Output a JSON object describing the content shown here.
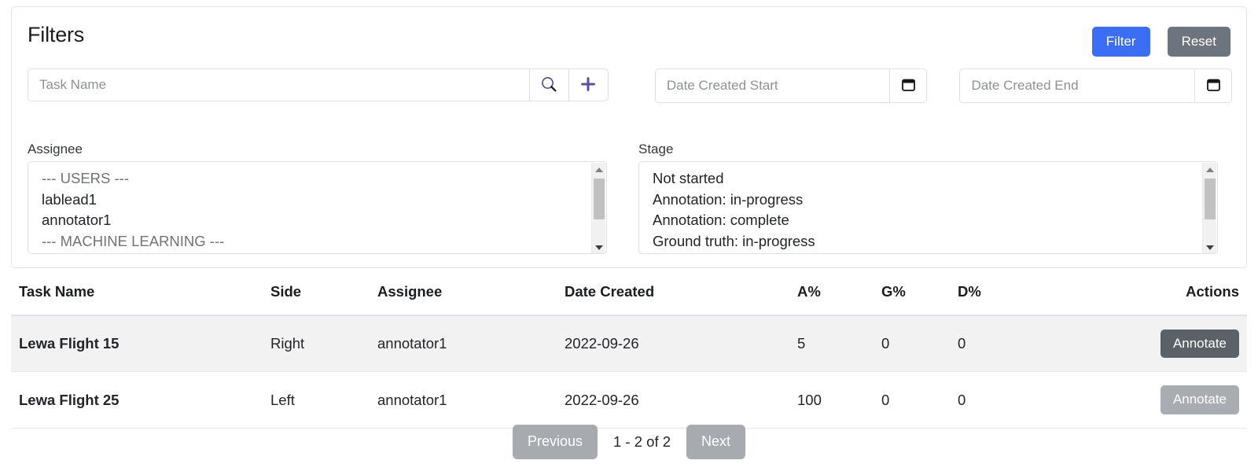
{
  "filters": {
    "title": "Filters",
    "filter_button": "Filter",
    "reset_button": "Reset",
    "task_name_placeholder": "Task Name",
    "task_name_value": "",
    "search_icon": "search-icon",
    "add_icon": "plus-icon",
    "date_start_placeholder": "Date Created Start",
    "date_start_value": "",
    "date_end_placeholder": "Date Created End",
    "date_end_value": "",
    "calendar_icon": "calendar-icon",
    "assignee": {
      "label": "Assignee",
      "options": [
        "--- USERS ---",
        "lablead1",
        "annotator1",
        "--- MACHINE LEARNING ---"
      ]
    },
    "stage": {
      "label": "Stage",
      "options": [
        "Not started",
        "Annotation: in-progress",
        "Annotation: complete",
        "Ground truth: in-progress"
      ]
    }
  },
  "table": {
    "columns": [
      "Task Name",
      "Side",
      "Assignee",
      "Date Created",
      "A%",
      "G%",
      "D%",
      "Actions"
    ],
    "rows": [
      {
        "task_name": "Lewa Flight 15",
        "side": "Right",
        "assignee": "annotator1",
        "date_created": "2022-09-26",
        "a_pct": "5",
        "g_pct": "0",
        "d_pct": "0",
        "action_label": "Annotate"
      },
      {
        "task_name": "Lewa Flight 25",
        "side": "Left",
        "assignee": "annotator1",
        "date_created": "2022-09-26",
        "a_pct": "100",
        "g_pct": "0",
        "d_pct": "0",
        "action_label": "Annotate"
      }
    ]
  },
  "pagination": {
    "previous_label": "Previous",
    "next_label": "Next",
    "range_label": "1 - 2 of 2"
  },
  "colors": {
    "filter_blue": "#3b6ef5",
    "reset_gray": "#6c757d",
    "annotate_active": "#5a6268",
    "annotate_disabled": "#a9adb1",
    "pager_gray": "#a7abaf",
    "icon_purple": "#5b4ea8",
    "row_stripe": "#f2f2f2"
  }
}
